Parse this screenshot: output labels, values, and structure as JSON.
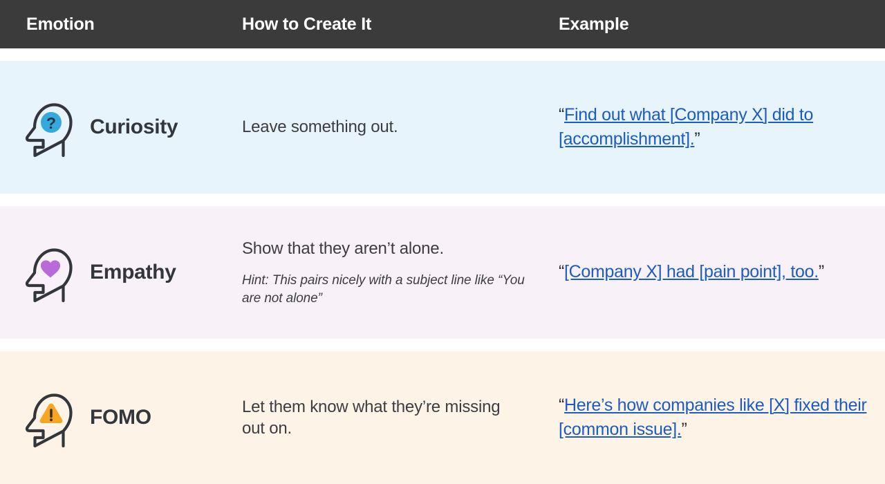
{
  "header": {
    "columns": [
      {
        "label": "Emotion"
      },
      {
        "label": "How to Create It"
      },
      {
        "label": "Example"
      }
    ]
  },
  "colors": {
    "header_bg": "#3b3b3b",
    "header_text": "#ffffff",
    "row_curiosity_bg": "#e7f4fb",
    "row_empathy_bg": "#f8f1f8",
    "row_fomo_bg": "#fdf4e7",
    "link_blue": "#1c5bc4",
    "body_text": "#3d3d41",
    "icon_outline": "#33363a",
    "curiosity_accent": "#35a8dd",
    "empathy_accent": "#b86ad9",
    "fomo_accent": "#f5a623"
  },
  "rows": [
    {
      "emotion": "Curiosity",
      "icon": "head-question-icon",
      "how_to": "Leave something out.",
      "hint": "",
      "example": {
        "open_quote": "“",
        "link_text": "Find out what [Company X] did to [accomplishment].",
        "close_quote": "”"
      }
    },
    {
      "emotion": "Empathy",
      "icon": "head-heart-icon",
      "how_to": "Show that they aren’t alone.",
      "hint": "Hint: This pairs nicely with a subject line like “You are not alone”",
      "example": {
        "open_quote": "“",
        "link_text": "[Company X] had [pain point], too.",
        "close_quote": "”"
      }
    },
    {
      "emotion": "FOMO",
      "icon": "head-warning-icon",
      "how_to": "Let them know what they’re missing out on.",
      "hint": "",
      "example": {
        "open_quote": "“",
        "link_text": "Here’s how companies like [X] fixed their [common issue].",
        "close_quote": "”"
      }
    }
  ]
}
